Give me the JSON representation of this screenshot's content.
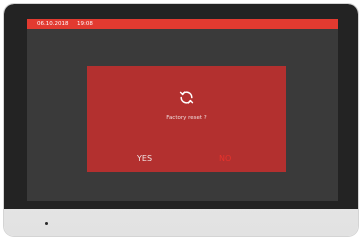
{
  "status_bar": {
    "date": "06.10.2018",
    "time": "19:08"
  },
  "dialog": {
    "icon": "refresh-icon",
    "message": "Factory reset ?",
    "yes_label": "YES",
    "no_label": "NO"
  },
  "colors": {
    "status_bar": "#e23a30",
    "dialog_bg": "#b3302f",
    "no_button": "#e8322c",
    "screen_bg": "#3a3a3a"
  }
}
